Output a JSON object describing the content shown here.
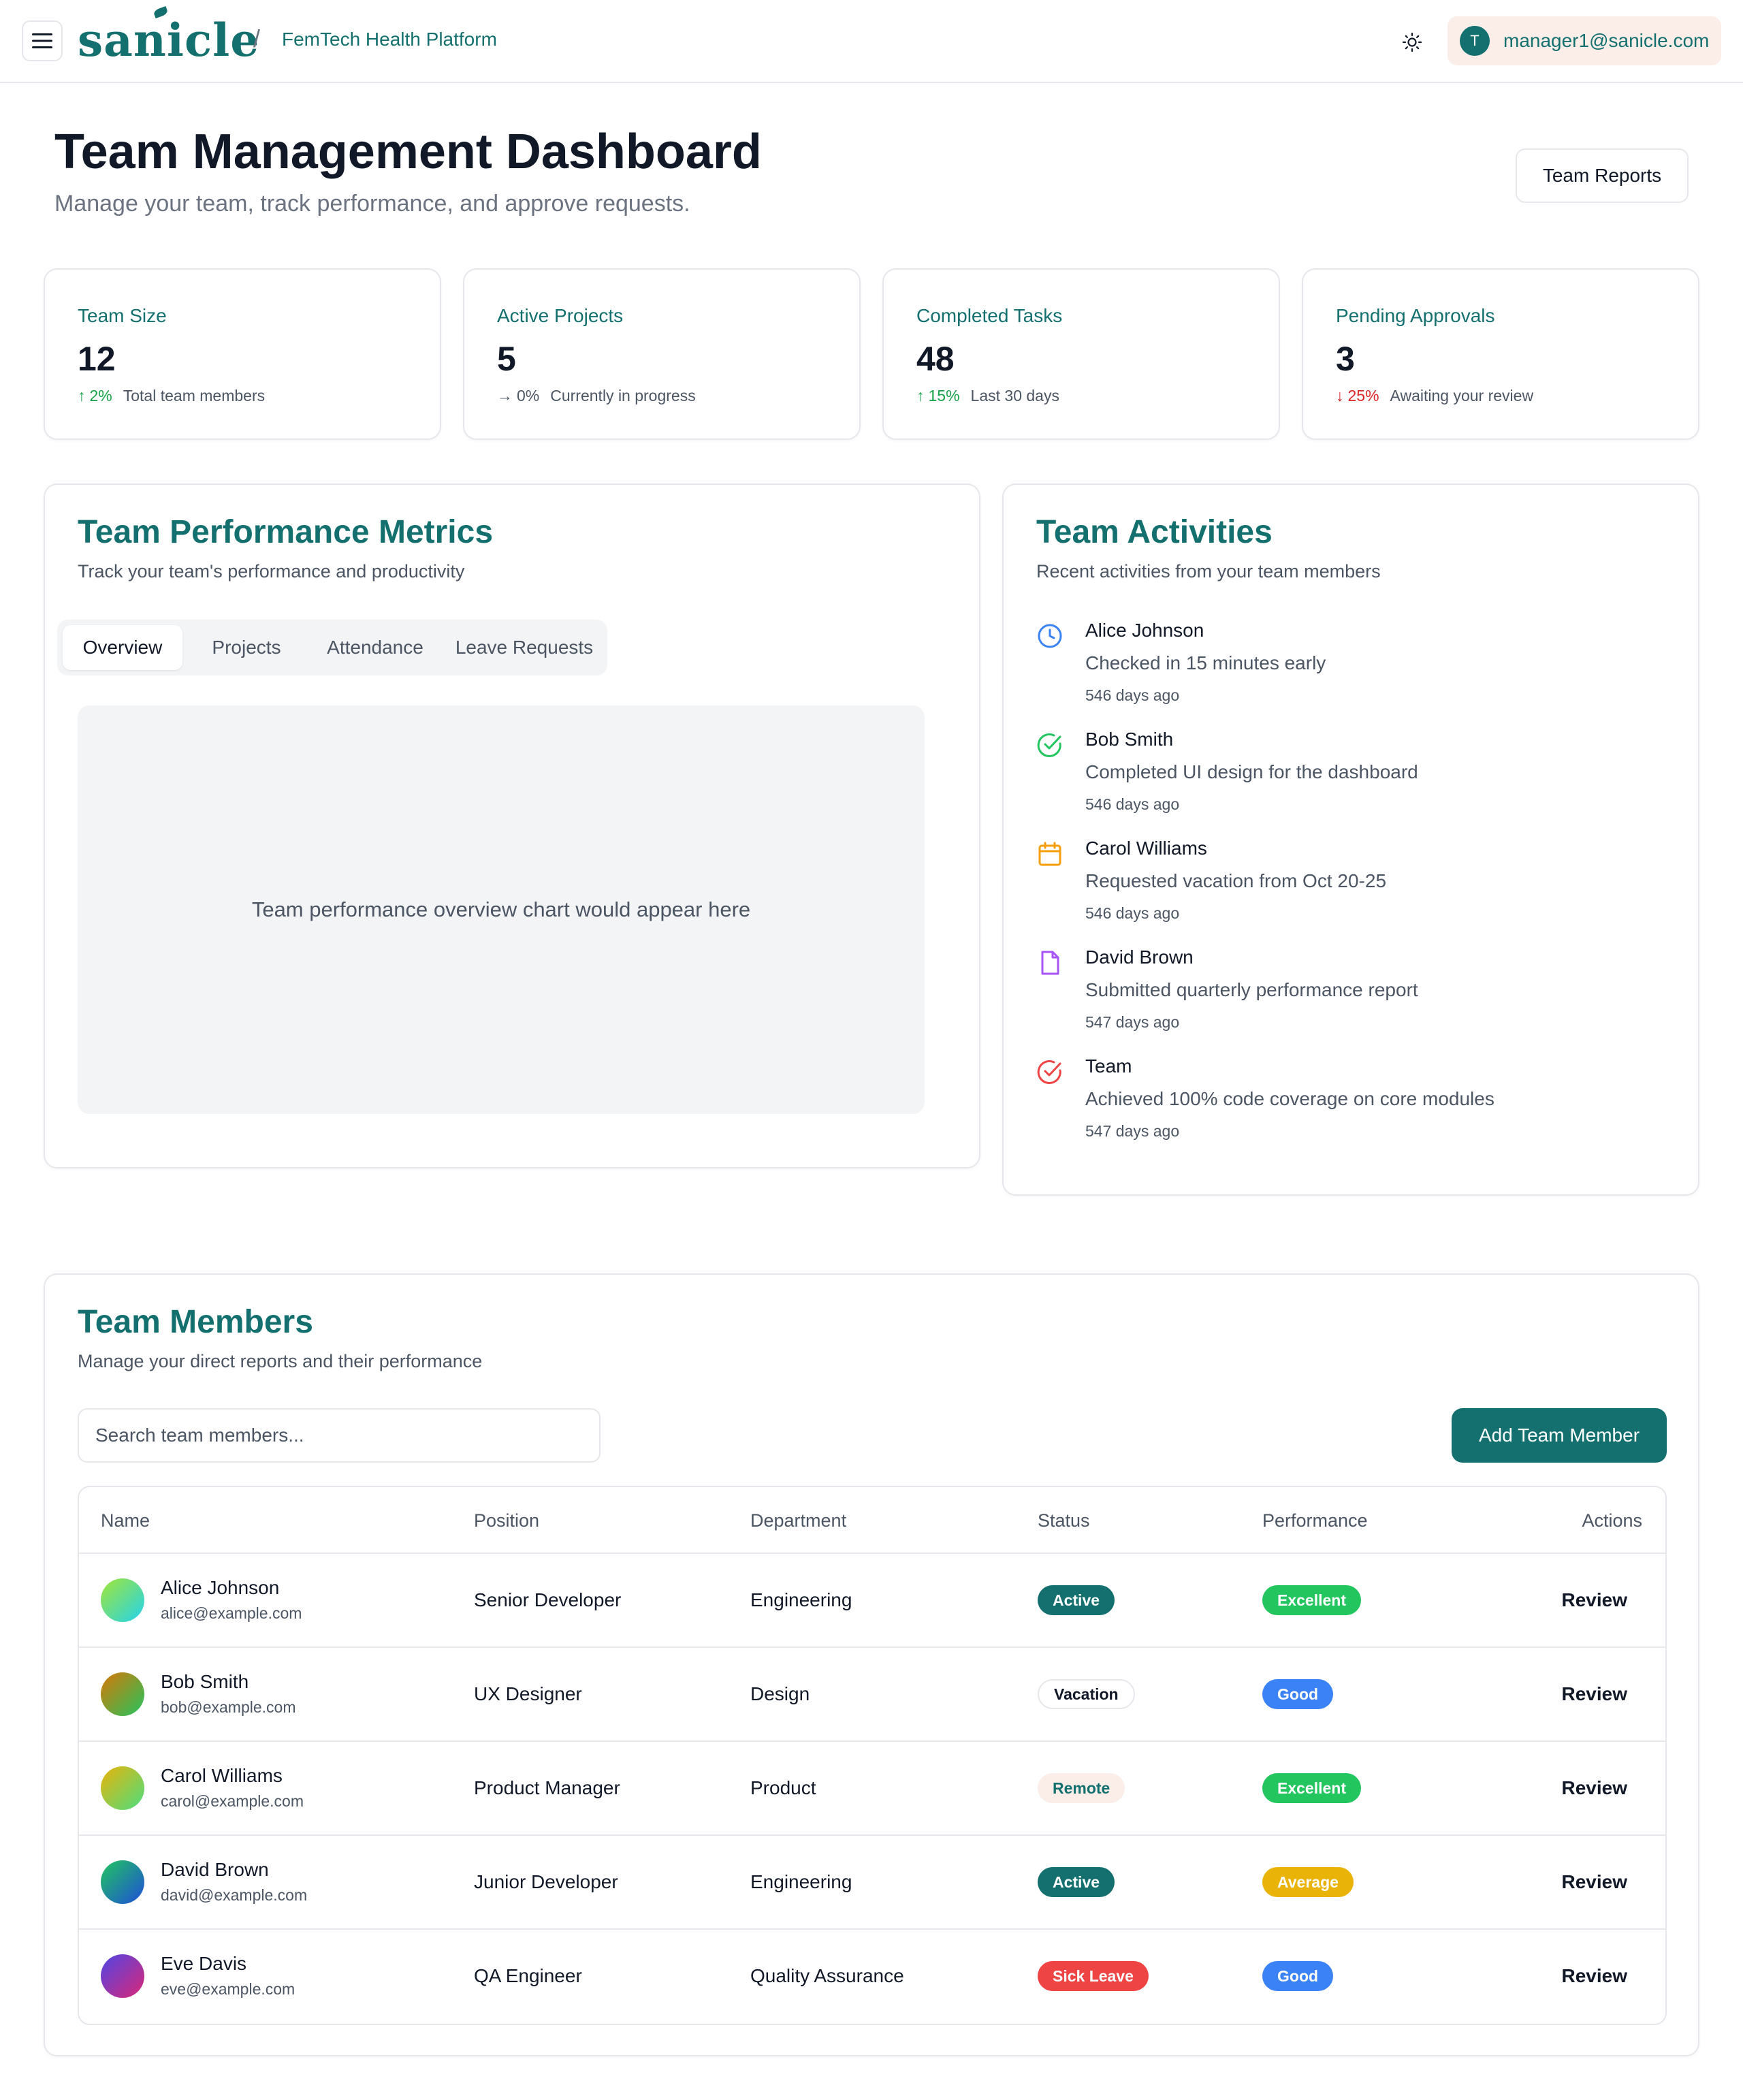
{
  "topbar": {
    "logo": "sanicle",
    "breadcrumb": "FemTech Health Platform",
    "separator": "/",
    "user_initial": "T",
    "user_email": "manager1@sanicle.com"
  },
  "header": {
    "title": "Team Management Dashboard",
    "subtitle": "Manage your team, track performance, and approve requests.",
    "reports_button": "Team Reports"
  },
  "stats": [
    {
      "label": "Team Size",
      "value": "12",
      "trend": "2%",
      "direction": "up",
      "desc": "Total team members"
    },
    {
      "label": "Active Projects",
      "value": "5",
      "trend": "0%",
      "direction": "flat",
      "desc": "Currently in progress"
    },
    {
      "label": "Completed Tasks",
      "value": "48",
      "trend": "15%",
      "direction": "up",
      "desc": "Last 30 days"
    },
    {
      "label": "Pending Approvals",
      "value": "3",
      "trend": "25%",
      "direction": "down",
      "desc": "Awaiting your review"
    }
  ],
  "performance": {
    "title": "Team Performance Metrics",
    "subtitle": "Track your team's performance and productivity",
    "tabs": [
      "Overview",
      "Projects",
      "Attendance",
      "Leave Requests"
    ],
    "active_tab": "Overview",
    "placeholder": "Team performance overview chart would appear here"
  },
  "activities": {
    "title": "Team Activities",
    "subtitle": "Recent activities from your team members",
    "items": [
      {
        "name": "Alice Johnson",
        "desc": "Checked in 15 minutes early",
        "time": "546 days ago",
        "icon": "clock-icon",
        "color": "#3b82f6"
      },
      {
        "name": "Bob Smith",
        "desc": "Completed UI design for the dashboard",
        "time": "546 days ago",
        "icon": "check-circle-icon",
        "color": "#22c55e"
      },
      {
        "name": "Carol Williams",
        "desc": "Requested vacation from Oct 20-25",
        "time": "546 days ago",
        "icon": "calendar-icon",
        "color": "#f59e0b"
      },
      {
        "name": "David Brown",
        "desc": "Submitted quarterly performance report",
        "time": "547 days ago",
        "icon": "file-icon",
        "color": "#a855f7"
      },
      {
        "name": "Team",
        "desc": "Achieved 100% code coverage on core modules",
        "time": "547 days ago",
        "icon": "target-check-icon",
        "color": "#ef4444"
      }
    ]
  },
  "members": {
    "title": "Team Members",
    "subtitle": "Manage your direct reports and their performance",
    "search_placeholder": "Search team members...",
    "add_button": "Add Team Member",
    "columns": [
      "Name",
      "Position",
      "Department",
      "Status",
      "Performance",
      "Actions"
    ],
    "action_label": "Review",
    "rows": [
      {
        "name": "Alice Johnson",
        "email": "alice@example.com",
        "position": "Senior Developer",
        "department": "Engineering",
        "status": "Active",
        "performance": "Excellent",
        "avatar_from": "#a3e635",
        "avatar_to": "#22d3ee"
      },
      {
        "name": "Bob Smith",
        "email": "bob@example.com",
        "position": "UX Designer",
        "department": "Design",
        "status": "Vacation",
        "performance": "Good",
        "avatar_from": "#d97706",
        "avatar_to": "#22c55e"
      },
      {
        "name": "Carol Williams",
        "email": "carol@example.com",
        "position": "Product Manager",
        "department": "Product",
        "status": "Remote",
        "performance": "Excellent",
        "avatar_from": "#eab308",
        "avatar_to": "#4ade80"
      },
      {
        "name": "David Brown",
        "email": "david@example.com",
        "position": "Junior Developer",
        "department": "Engineering",
        "status": "Active",
        "performance": "Average",
        "avatar_from": "#22c55e",
        "avatar_to": "#1d4ed8"
      },
      {
        "name": "Eve Davis",
        "email": "eve@example.com",
        "position": "QA Engineer",
        "department": "Quality Assurance",
        "status": "Sick Leave",
        "performance": "Good",
        "avatar_from": "#4f46e5",
        "avatar_to": "#db2777"
      }
    ]
  },
  "colors": {
    "brand": "#13706f",
    "status_active_bg": "#13706f",
    "status_sick_bg": "#ef4444",
    "status_remote_bg": "#fbeee9",
    "perf_excellent_bg": "#22c55e",
    "perf_good_bg": "#3b82f6",
    "perf_average_bg": "#eab308"
  }
}
